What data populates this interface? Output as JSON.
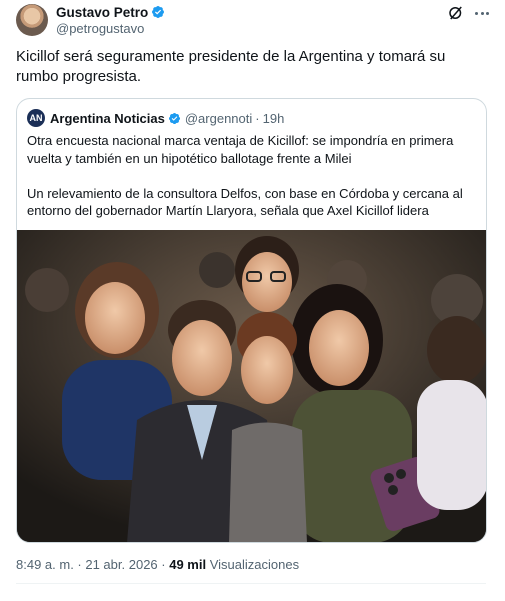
{
  "author": {
    "display_name": "Gustavo Petro",
    "handle": "@petrogustavo",
    "verified": true
  },
  "tweet": {
    "text": "Kicillof será seguramente presidente de la Argentina y tomará su rumbo progresista."
  },
  "quote": {
    "display_name": "Argentina Noticias",
    "handle": "@argennoti",
    "time": "19h",
    "logo_text": "AN",
    "paragraph_1": "Otra encuesta nacional marca ventaja de Kicillof: se impondría en primera vuelta y también en un hipotético ballotage frente a Milei",
    "paragraph_2": "Un relevamiento de la consultora Delfos, con base en Córdoba y cercana al entorno del gobernador Martín Llaryora, señala que Axel Kicillof lidera"
  },
  "footer": {
    "timestamp": "8:49 a. m. · 21 abr. 2026 ·",
    "views_count": "49 mil",
    "views_label": "Visualizaciones"
  },
  "colors": {
    "verified_blue": "#1d9bf0",
    "secondary_text": "#536471",
    "border": "#cfd9de"
  },
  "icons": [
    "verified-badge-icon",
    "grok-icon",
    "more-icon"
  ]
}
